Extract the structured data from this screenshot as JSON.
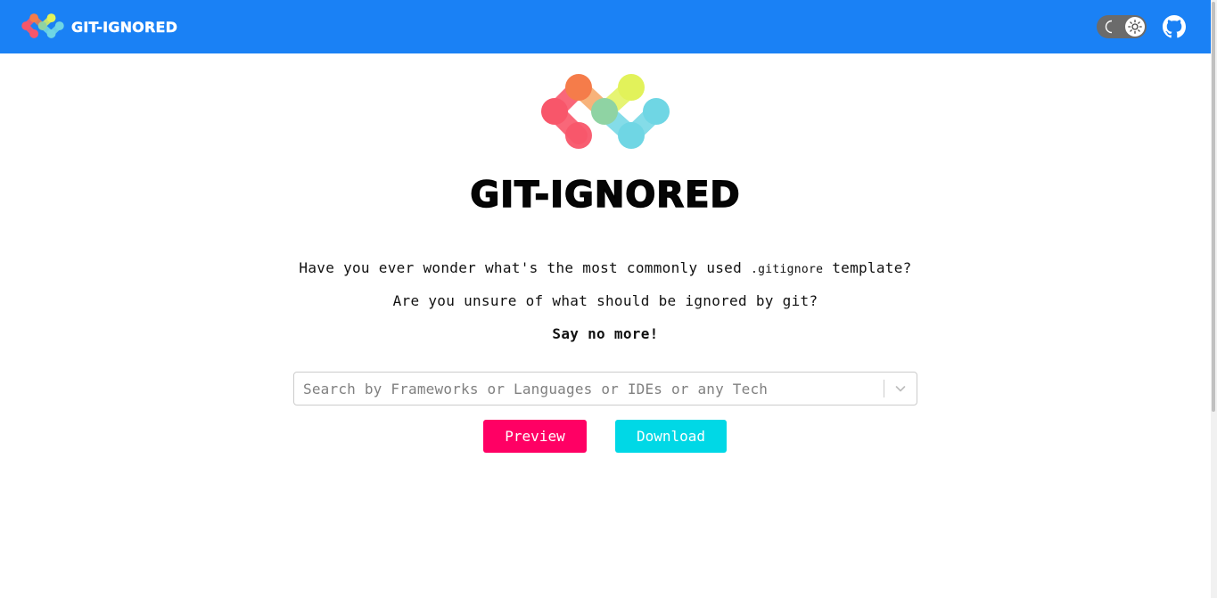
{
  "header": {
    "brand_name": "GIT-IGNORED"
  },
  "hero": {
    "title": "GIT-IGNORED"
  },
  "tagline": {
    "line1_before": "Have you ever wonder what's the most commonly used ",
    "line1_code": ".gitignore",
    "line1_after": " template?",
    "line2": "Are you unsure of what should be ignored by git?",
    "line3": "Say no more!"
  },
  "search": {
    "placeholder": "Search by Frameworks or Languages or IDEs or any Tech",
    "value": ""
  },
  "actions": {
    "preview_label": "Preview",
    "download_label": "Download"
  },
  "icons": {
    "logo": "git-ignored-logo-icon",
    "moon": "moon-icon",
    "sun": "sun-icon",
    "github": "github-icon",
    "chevron": "chevron-down-icon"
  },
  "colors": {
    "header_bg": "#1a81f5",
    "preview_bg": "#ff0064",
    "download_bg": "#00d8e6",
    "logo_red": "#f8566a",
    "logo_orange": "#f57c4a",
    "logo_yellow": "#e2f25a",
    "logo_green": "#8fd3a3",
    "logo_cyan": "#6fd6e4"
  }
}
